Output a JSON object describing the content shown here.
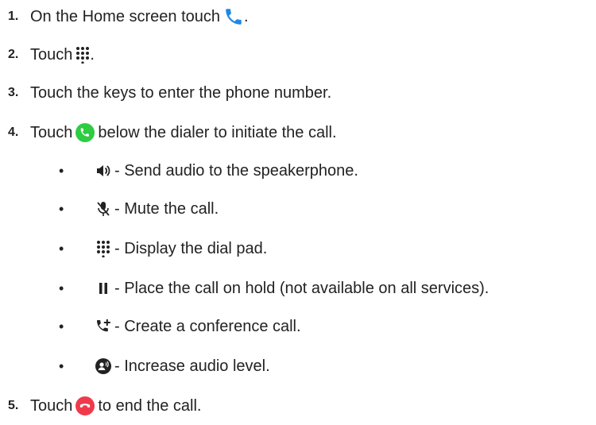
{
  "steps": [
    {
      "number": "1.",
      "text_before": "On the Home screen touch",
      "icon": "phone-app-icon",
      "text_after": "."
    },
    {
      "number": "2.",
      "text_before": "Touch",
      "icon": "dialpad-icon",
      "text_after": "."
    },
    {
      "number": "3.",
      "text_before": "Touch the keys to enter the phone number.",
      "icon": "",
      "text_after": ""
    },
    {
      "number": "4.",
      "text_before": "Touch",
      "icon": "call-button-icon",
      "text_after": "below the dialer to initiate the call."
    },
    {
      "number": "5.",
      "text_before": "Touch",
      "icon": "end-call-icon",
      "text_after": "to end the call."
    }
  ],
  "sub_items": [
    {
      "bullet": "•",
      "icon": "speaker-icon",
      "text": "- Send audio to the speakerphone."
    },
    {
      "bullet": "•",
      "icon": "mute-microphone-icon",
      "text": "- Mute the call."
    },
    {
      "bullet": "•",
      "icon": "dialpad-icon",
      "text": "- Display the dial pad."
    },
    {
      "bullet": "•",
      "icon": "pause-icon",
      "text": "- Place the call on hold (not available on all services)."
    },
    {
      "bullet": "•",
      "icon": "add-call-icon",
      "text": "- Create a conference call."
    },
    {
      "bullet": "•",
      "icon": "increase-audio-icon",
      "text": "- Increase audio level."
    }
  ],
  "colors": {
    "phone_blue": "#1e88e5",
    "call_green": "#2ecc40",
    "end_red": "#f03a4c",
    "icon_dark": "#222222"
  }
}
